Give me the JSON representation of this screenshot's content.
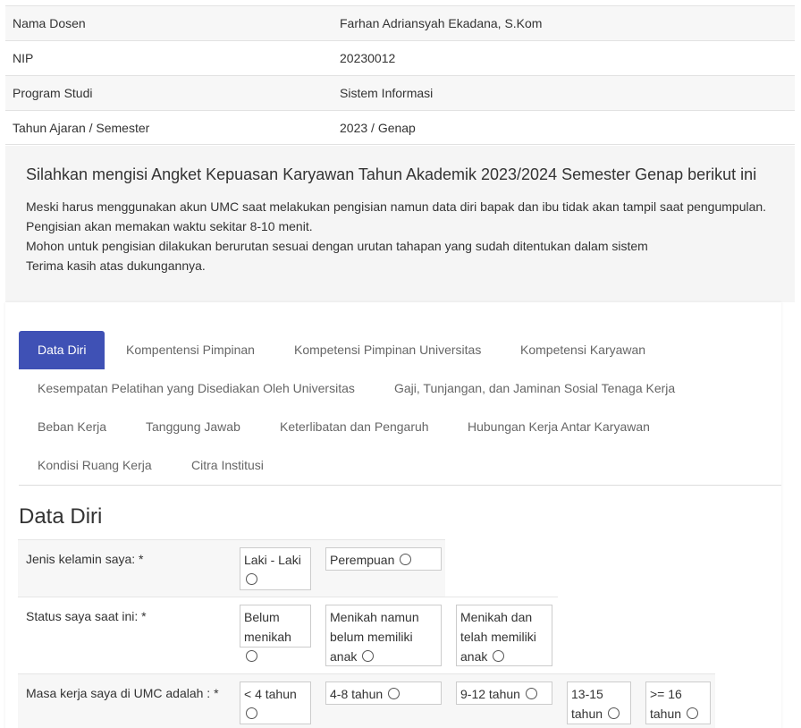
{
  "info": [
    {
      "label": "Nama Dosen",
      "value": "Farhan Adriansyah Ekadana, S.Kom"
    },
    {
      "label": "NIP",
      "value": "20230012"
    },
    {
      "label": "Program Studi",
      "value": "Sistem Informasi"
    },
    {
      "label": "Tahun Ajaran / Semester",
      "value": "2023 / Genap"
    }
  ],
  "intro": {
    "title": "Silahkan mengisi Angket Kepuasan Karyawan Tahun Akademik 2023/2024 Semester Genap berikut ini",
    "lines": [
      "Meski harus menggunakan akun UMC saat melakukan pengisian namun data diri bapak dan ibu tidak akan tampil saat pengumpulan.",
      "Pengisian akan memakan waktu sekitar 8-10 menit.",
      "Mohon untuk pengisian dilakukan berurutan sesuai dengan urutan tahapan yang sudah ditentukan dalam sistem",
      "Terima kasih atas dukungannya."
    ]
  },
  "tabs": [
    "Data Diri",
    "Kompentensi Pimpinan",
    "Kompetensi Pimpinan Universitas",
    "Kompetensi Karyawan",
    "Kesempatan Pelatihan yang Disediakan Oleh Universitas",
    "Gaji, Tunjangan, dan Jaminan Sosial Tenaga Kerja",
    "Beban Kerja",
    "Tanggung Jawab",
    "Keterlibatan dan Pengaruh",
    "Hubungan Kerja Antar Karyawan",
    "Kondisi Ruang Kerja",
    "Citra Institusi"
  ],
  "section_title": "Data Diri",
  "questions": [
    {
      "label": "Jenis kelamin saya: *",
      "options": [
        "Laki - Laki",
        "Perempuan"
      ]
    },
    {
      "label": "Status saya saat ini: *",
      "options": [
        "Belum menikah",
        "Menikah namun belum memiliki anak",
        "Menikah dan telah memiliki anak"
      ]
    },
    {
      "label": "Masa kerja saya di UMC adalah : *",
      "options": [
        "< 4 tahun",
        "4-8 tahun",
        "9-12 tahun",
        "13-15 tahun",
        ">= 16 tahun"
      ]
    }
  ]
}
